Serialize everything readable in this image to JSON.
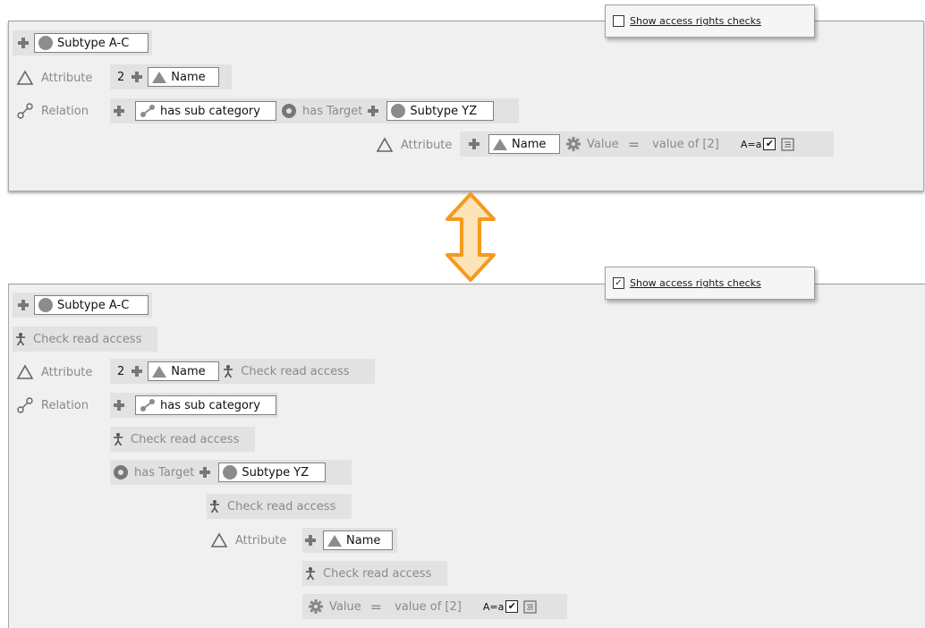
{
  "top": {
    "checkbox": {
      "label": "Show access rights checks",
      "checked": false
    },
    "subtype_root": "Subtype A-C",
    "attribute_label": "Attribute",
    "attribute_index": "2",
    "attribute_name": "Name",
    "relation_label": "Relation",
    "relation_name": "has sub category",
    "has_target_label": "has Target",
    "target_subtype": "Subtype YZ",
    "nested_attribute_label": "Attribute",
    "nested_attribute_name": "Name",
    "value_label": "Value",
    "equals": "=",
    "value_of": "value of [2]",
    "case_label": "A=a",
    "case_checked": "✔"
  },
  "bottom": {
    "checkbox": {
      "label": "Show access rights checks",
      "checked": true,
      "mark": "✓"
    },
    "subtype_root": "Subtype A-C",
    "check_read_access": "Check read access",
    "attribute_label": "Attribute",
    "attribute_index": "2",
    "attribute_name": "Name",
    "relation_label": "Relation",
    "relation_name": "has sub category",
    "has_target_label": "has Target",
    "target_subtype": "Subtype YZ",
    "nested_attribute_label": "Attribute",
    "nested_attribute_name": "Name",
    "value_label": "Value",
    "equals": "=",
    "value_of": "value of [2]",
    "case_label": "A=a",
    "case_checked": "✔"
  },
  "colors": {
    "arrow_fill": "#fde3b8",
    "arrow_stroke": "#f59a1e",
    "panel_bg": "#f0f0f0",
    "row_bg": "#e2e2e2"
  },
  "icons": [
    "plus-icon",
    "circle-icon",
    "triangle-icon",
    "triangle-outline-icon",
    "link-icon",
    "target-icon",
    "gear-icon",
    "person-icon",
    "document-icon",
    "double-arrow-icon"
  ]
}
